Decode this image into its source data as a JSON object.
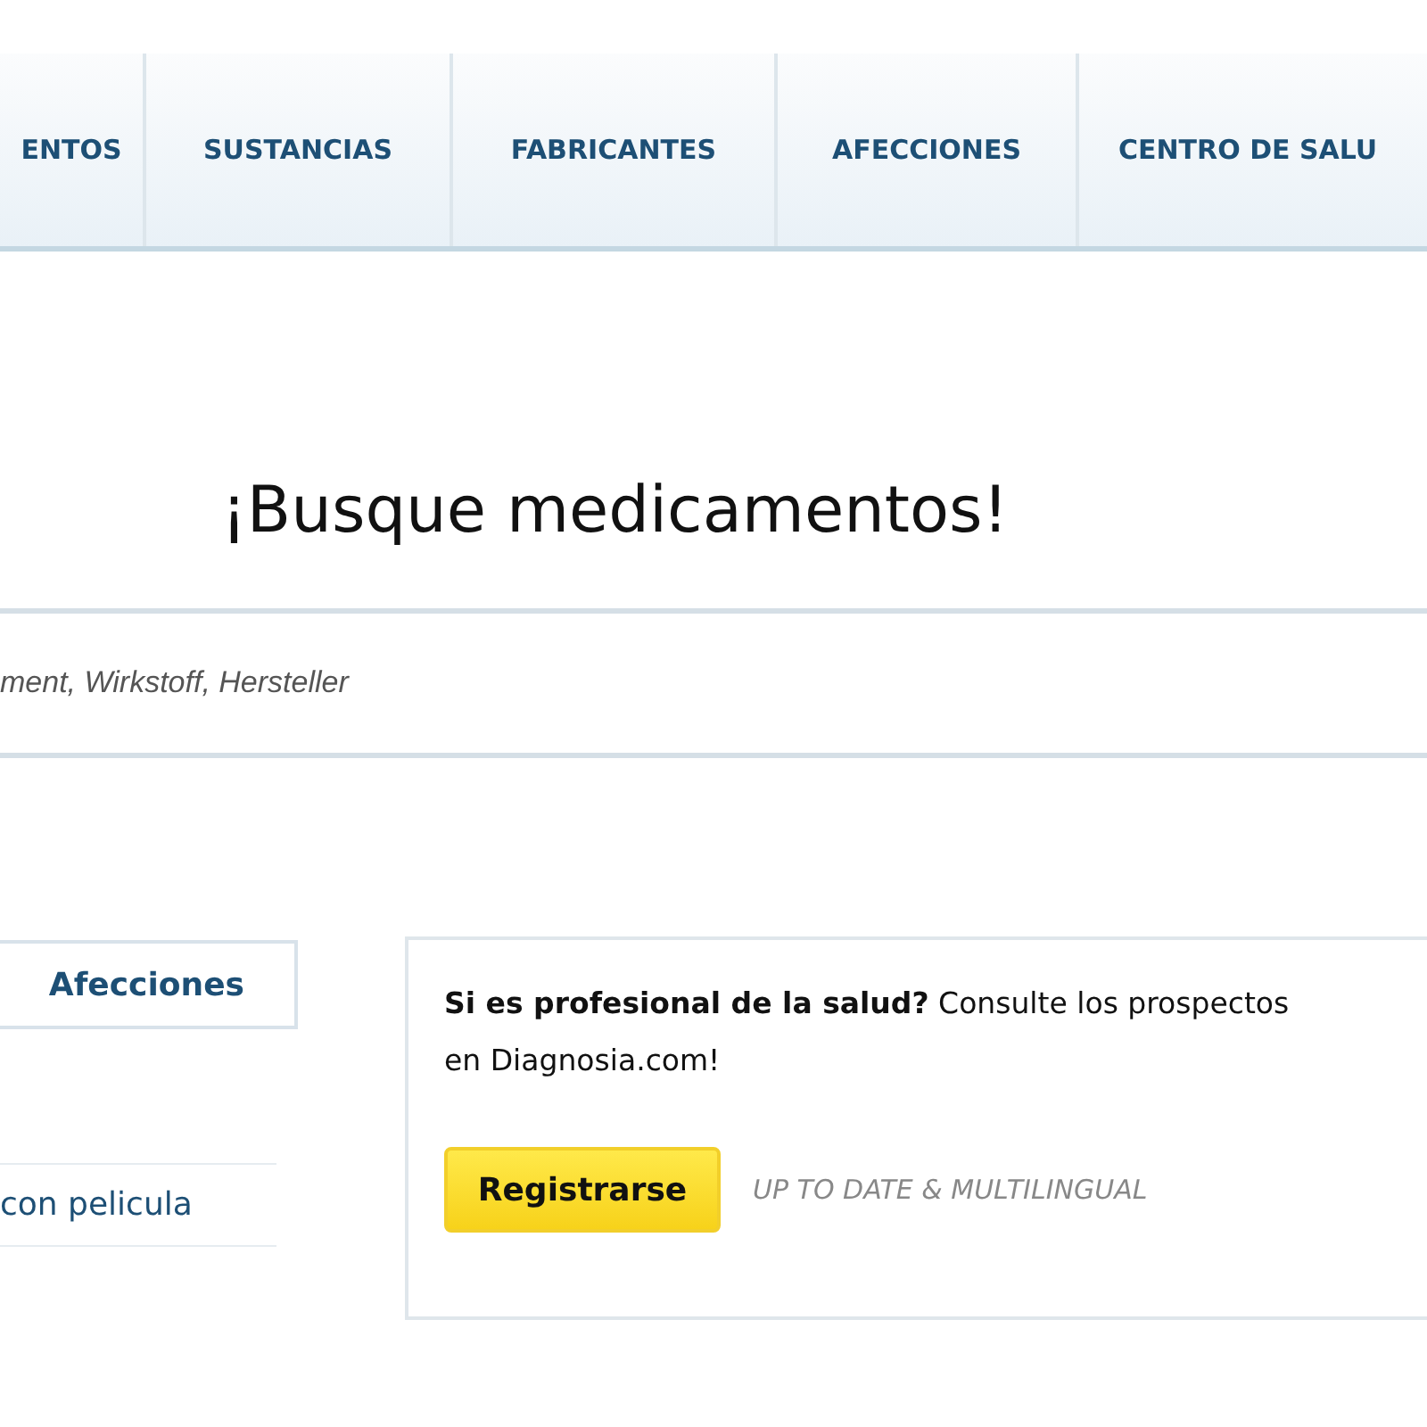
{
  "nav": {
    "tabs": [
      {
        "label": "ENTOS"
      },
      {
        "label": "SUSTANCIAS"
      },
      {
        "label": "FABRICANTES"
      },
      {
        "label": "AFECCIONES"
      },
      {
        "label": "CENTRO DE SALU"
      }
    ]
  },
  "heading": "¡Busque medicamentos!",
  "search": {
    "placeholder": "ment, Wirkstoff, Hersteller"
  },
  "left": {
    "tab": "Afecciones",
    "items": [
      "con pelicula"
    ]
  },
  "promo": {
    "text": "**Si es profesional de la salud?** Consulte los prospectos",
    "text_2": "en Diagnosia.com!",
    "button": "Registrarse",
    "tagline": "UP TO DATE & MULTILINGUAL"
  }
}
